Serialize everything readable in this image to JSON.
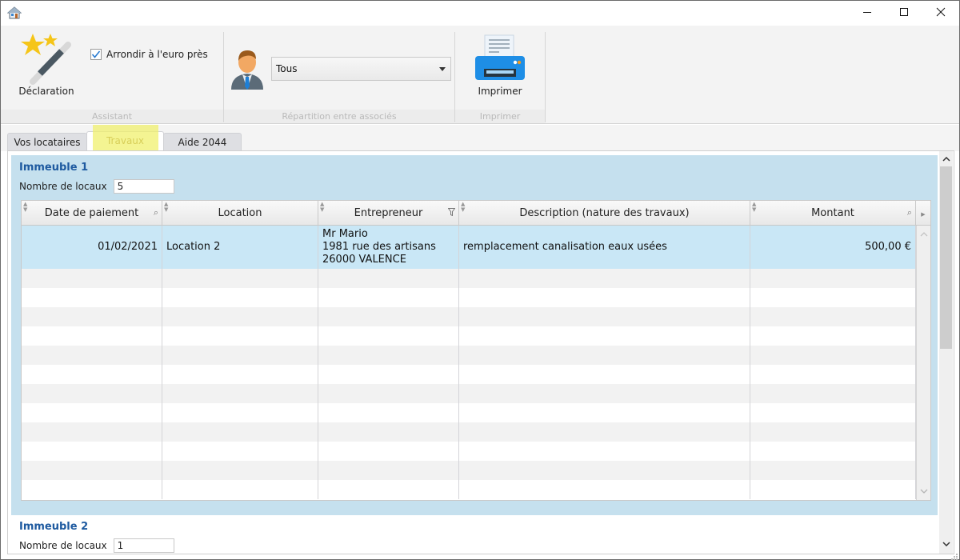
{
  "window": {
    "app_icon": "home-icon",
    "controls": {
      "minimize": "minimize-icon",
      "maximize": "maximize-icon",
      "close": "close-icon"
    }
  },
  "ribbon": {
    "groups": [
      {
        "label": "Assistant",
        "declaration_button": {
          "label": "Déclaration",
          "icon": "magic-wand-stars-icon"
        },
        "round_checkbox": {
          "label": "Arrondir à l'euro près",
          "checked": true
        }
      },
      {
        "label": "Répartition entre associés",
        "icon": "person-icon",
        "associate_select": {
          "value": "Tous"
        }
      },
      {
        "label": "Imprimer",
        "print_button": {
          "label": "Imprimer",
          "icon": "printer-icon"
        }
      }
    ]
  },
  "tabs": [
    {
      "label": "Vos locataires",
      "active": false
    },
    {
      "label": "Travaux",
      "active": true
    },
    {
      "label": "Aide 2044",
      "active": false
    }
  ],
  "buildings": [
    {
      "title": "Immeuble 1",
      "nb_locaux_label": "Nombre de locaux",
      "nb_locaux_value": "5",
      "grid": {
        "columns": [
          {
            "label": "Date de paiement",
            "icon": "search-icon"
          },
          {
            "label": "Location",
            "icon": ""
          },
          {
            "label": "Entrepreneur",
            "icon": "filter-icon"
          },
          {
            "label": "Description (nature des travaux)",
            "icon": ""
          },
          {
            "label": "Montant",
            "icon": "search-icon"
          }
        ],
        "rows": [
          {
            "date": "01/02/2021",
            "location": "Location 2",
            "entrepreneur": "Mr Mario\n1981 rue des artisans\n26000 VALENCE",
            "description": "remplacement canalisation eaux usées",
            "montant": "500,00 €"
          }
        ],
        "empty_rows": 12
      }
    },
    {
      "title": "Immeuble 2",
      "nb_locaux_label": "Nombre de locaux",
      "nb_locaux_value": "1"
    }
  ],
  "colors": {
    "accent_blue": "#1e5aa0",
    "panel_bg": "#c5e0ee",
    "selected_row": "#c9e7f6",
    "tab_highlight": "#f0f06e"
  }
}
